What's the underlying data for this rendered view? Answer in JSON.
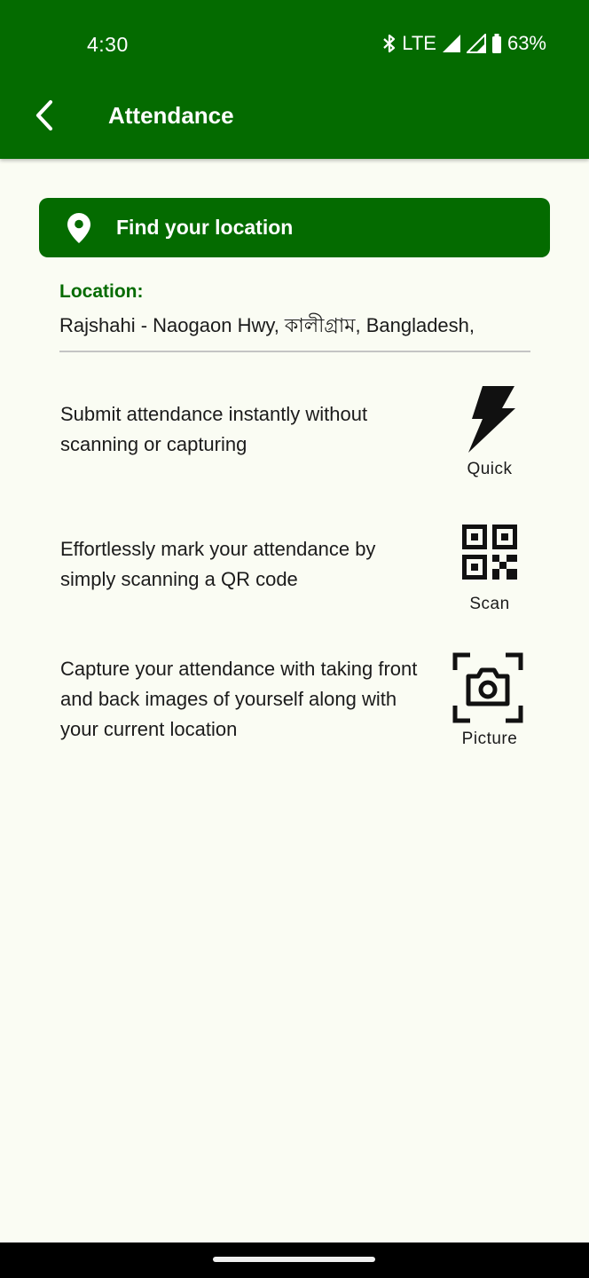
{
  "status_bar": {
    "time": "4:30",
    "network": "LTE",
    "battery": "63%",
    "icons": [
      "bluetooth-icon",
      "signal-icon",
      "signal-icon",
      "battery-icon"
    ]
  },
  "app_bar": {
    "back_icon": "chevron-left-icon",
    "title": "Attendance",
    "color": "#046b00"
  },
  "find_location": {
    "icon": "location-pin-icon",
    "label": "Find your location"
  },
  "location": {
    "label": "Location:",
    "value": "Rajshahi - Naogaon Hwy, কালীগ্রাম, Bangladesh,"
  },
  "options": [
    {
      "description": "Submit attendance instantly without scanning or capturing",
      "icon": "lightning-bolt-icon",
      "label": "Quick"
    },
    {
      "description": "Effortlessly mark your attendance by simply scanning a QR code",
      "icon": "qr-code-icon",
      "label": "Scan"
    },
    {
      "description": "Capture your attendance with taking front and back images of yourself along with your current location",
      "icon": "camera-icon",
      "label": "Picture"
    }
  ]
}
